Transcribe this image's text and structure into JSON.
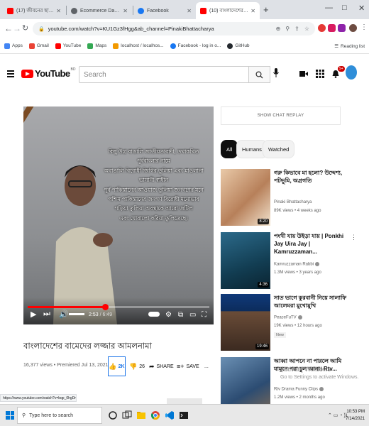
{
  "browser": {
    "tabs": [
      {
        "title": "(17) জীবনের ছায়ী কিছু সু দিয়া",
        "active": false,
        "favicon_color": "#ff0000"
      },
      {
        "title": "Ecommerce Dashboard",
        "active": false,
        "favicon_color": "#5f6368"
      },
      {
        "title": "Facebook",
        "active": false,
        "favicon_color": "#1877f2"
      },
      {
        "title": "(10) বাংলাদেশের বামেদের লজ্জার",
        "active": true,
        "favicon_color": "#ff0000"
      }
    ],
    "new_tab": "+",
    "window_controls": [
      "—",
      "□",
      "✕"
    ],
    "url": "youtube.com/watch?v=KU1Gz3fHgg&ab_channel=PinakiBhattacharya"
  },
  "bookmarks": {
    "items": [
      {
        "label": "Apps",
        "color": "#4285f4"
      },
      {
        "label": "Gmail",
        "color": "#ea4335"
      },
      {
        "label": "YouTube",
        "color": "#ff0000"
      },
      {
        "label": "Maps",
        "color": "#34a853"
      },
      {
        "label": "localhost / localhos...",
        "color": "#f29900"
      },
      {
        "label": "Facebook - log in o...",
        "color": "#1877f2"
      },
      {
        "label": "GitHub",
        "color": "#24292e"
      }
    ],
    "reading_list": "Reading list"
  },
  "youtube": {
    "logo_text": "YouTube",
    "logo_country": "BD",
    "search_placeholder": "Search",
    "notification_count": "9+"
  },
  "player": {
    "caption_lines": [
      "কিছু উগ্র বাঙালি জাতীয়তাবাদী, তথাকথিত পূর্ববাংলার নামে",
      "অবাঙালি বিরোধী জিগির তুলিয়া এবং মাওলানা ভাসানী স্বাধীন",
      "পূর্ব পাকিস্তানের আওয়াজ তুলিয়া জনগণের মনে",
      "পশ্চিম পাকিস্তানের জনগণ বিরোধী মনোভাব",
      "গড়িয়া তুলিয়া অবস্থাকে আরো জটিল",
      "এবং ঘোরালো করিয়া তুলিতেছে।"
    ],
    "current_time": "2:53",
    "duration": "6:49",
    "progress": 0.424
  },
  "video": {
    "title": "বাংলাদেশের বামেদের লজ্জার আমলনামা",
    "views": "16,377 views",
    "premiered": "Premiered Jul 13, 2021",
    "likes": "2K",
    "dislikes": "26",
    "share_label": "SHARE",
    "save_label": "SAVE",
    "more_label": "..."
  },
  "sidebar": {
    "chat_replay": "SHOW CHAT REPLAY",
    "chips": [
      "All",
      "Humans",
      "Watched"
    ],
    "recommendations": [
      {
        "title": "গরু কিভাবে মা হলো? উদ্দেশ্য, পটভূমি, অগ্রগতি",
        "channel": "Pinaki Bhattacharya",
        "meta": "89K views • 4 weeks ago",
        "duration": "8:20",
        "verified": false,
        "new": false
      },
      {
        "title": "পংখী যায় উইড়া যায় | Ponkhi Jay Uira Jay | Kamruzzaman...",
        "channel": "Kamruzzaman Rabbi",
        "meta": "1.3M views • 3 years ago",
        "duration": "4:36",
        "verified": true,
        "new": false
      },
      {
        "title": "সাত ভাগে কুরবানী নিয়ে সালাফি আলেমরা মুখোমুখি",
        "channel": "PeaceFuTV",
        "meta": "19K views • 12 hours ago",
        "duration": "19:46",
        "verified": true,
        "new": true,
        "new_label": "New"
      },
      {
        "title": "আব্বা আপনে না পারলে আমি যামুনে পরা চুল আনা। Rtv...",
        "channel": "Rtv Drama Funny Clips",
        "meta": "1.2M views • 2 months ago",
        "duration": "",
        "verified": true,
        "new": false
      }
    ]
  },
  "windows_watermark": {
    "line1": "Activate Windows",
    "line2": "Go to Settings to activate Windows."
  },
  "status_link": "https://www.youtube.com/watch?v=bqp_0hgDm4",
  "taskbar": {
    "search_placeholder": "Type here to search",
    "time": "10:53 PM",
    "date": "7/14/2021"
  }
}
